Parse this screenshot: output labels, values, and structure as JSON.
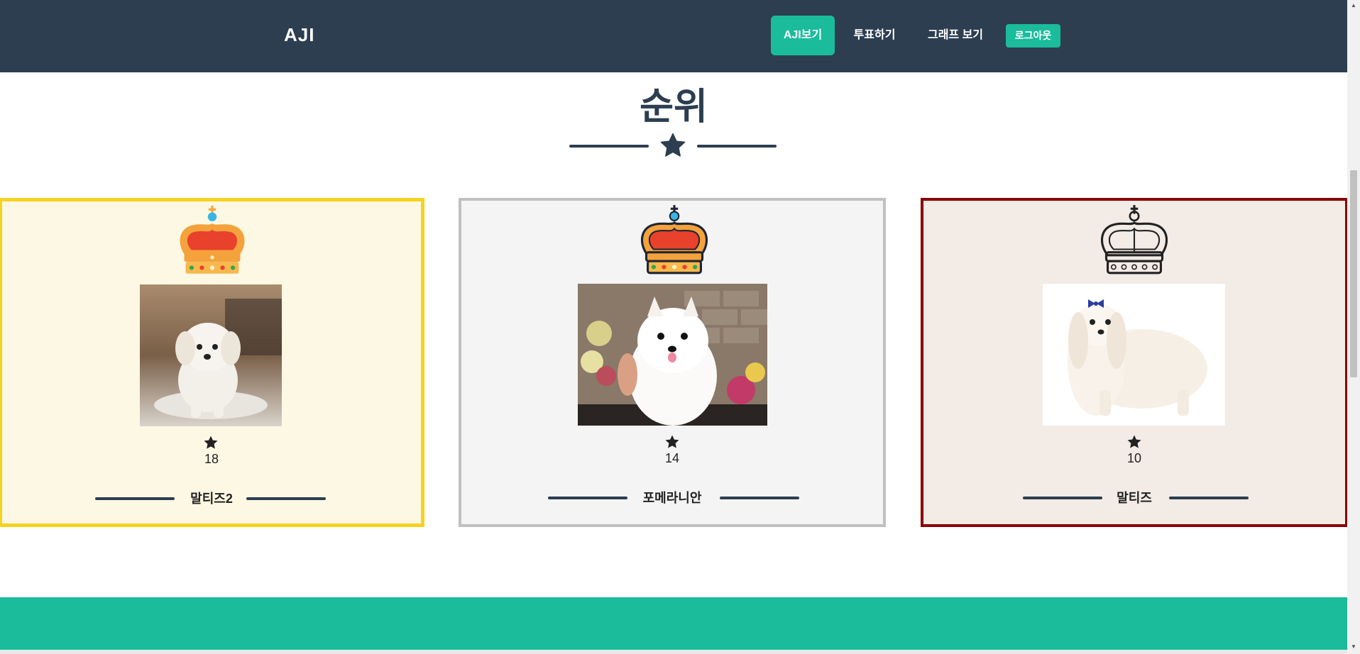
{
  "navbar": {
    "brand": "AJI",
    "items": [
      {
        "label": "AJI보기",
        "active": true
      },
      {
        "label": "투표하기",
        "active": false
      },
      {
        "label": "그래프 보기",
        "active": false
      }
    ],
    "logout_label": "로그아웃"
  },
  "section": {
    "title": "순위"
  },
  "rankings": [
    {
      "rank": 1,
      "tier": "gold",
      "votes": "18",
      "name": "말티즈2",
      "border_color": "#f7d21e",
      "icon": "star-icon"
    },
    {
      "rank": 2,
      "tier": "silver",
      "votes": "14",
      "name": "포메라니안",
      "border_color": "#c0c0c0",
      "icon": "star-icon"
    },
    {
      "rank": 3,
      "tier": "bronze",
      "votes": "10",
      "name": "말티즈",
      "border_color": "#8b0000",
      "icon": "star-icon"
    }
  ],
  "colors": {
    "primary": "#2c3e50",
    "accent": "#1abc9c"
  }
}
